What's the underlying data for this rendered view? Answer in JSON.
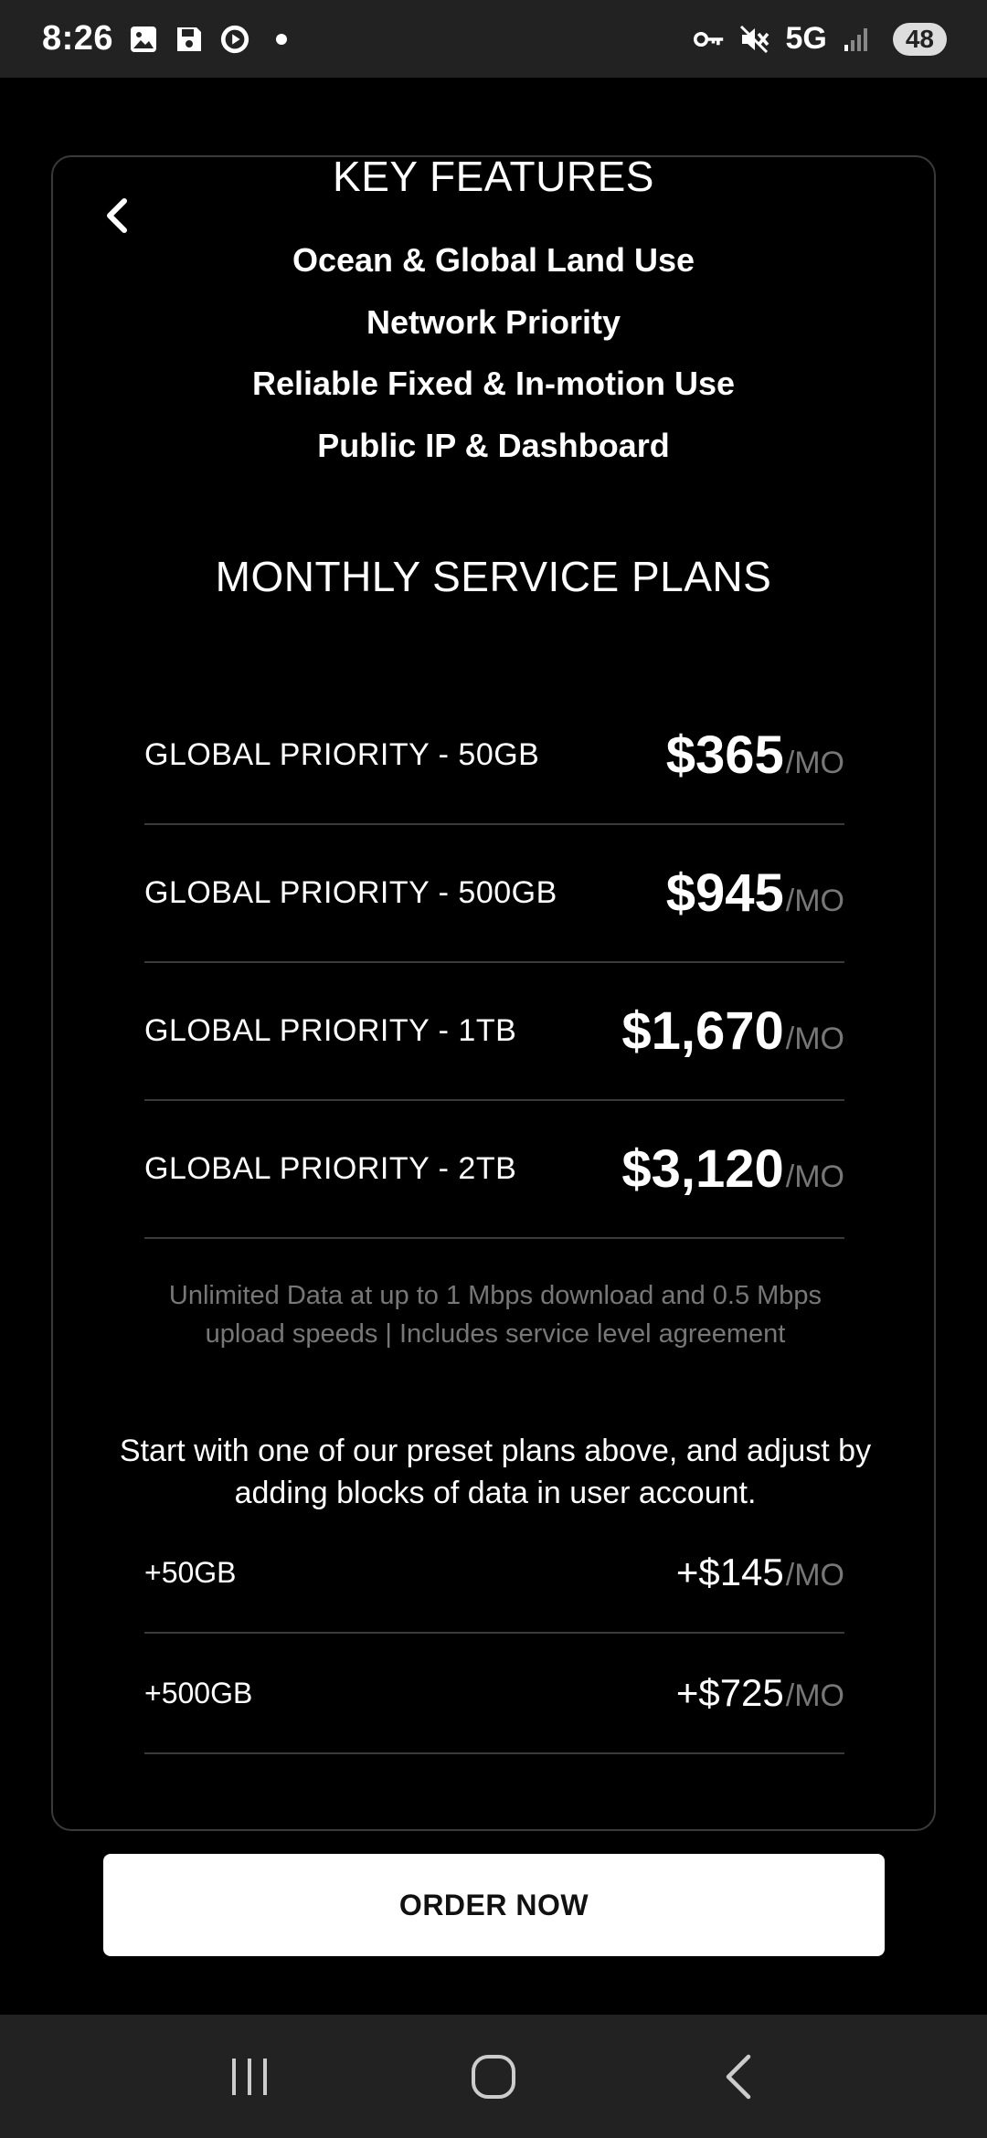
{
  "status_bar": {
    "time": "8:26",
    "network": "5G",
    "battery": "48",
    "left_icons": [
      "gallery-icon",
      "save-icon",
      "play-circle-icon"
    ],
    "right_icons": [
      "key-icon",
      "mute-icon",
      "signal-icon"
    ]
  },
  "key_features": {
    "title": "KEY FEATURES",
    "items": [
      "Ocean & Global Land Use",
      "Network Priority",
      "Reliable Fixed & In-motion Use",
      "Public IP & Dashboard"
    ]
  },
  "plans": {
    "title": "MONTHLY SERVICE PLANS",
    "items": [
      {
        "name": "GLOBAL PRIORITY - 50GB",
        "price": "$365",
        "unit": "/MO"
      },
      {
        "name": "GLOBAL PRIORITY - 500GB",
        "price": "$945",
        "unit": "/MO"
      },
      {
        "name": "GLOBAL PRIORITY - 1TB",
        "price": "$1,670",
        "unit": "/MO"
      },
      {
        "name": "GLOBAL PRIORITY - 2TB",
        "price": "$3,120",
        "unit": "/MO"
      }
    ],
    "note": "Unlimited Data at up to 1 Mbps download and 0.5 Mbps upload speeds | Includes service level agreement"
  },
  "addons": {
    "intro": "Start with one of our preset plans above, and adjust by adding blocks of data in user account.",
    "items": [
      {
        "name": "+50GB",
        "price": "+$145",
        "unit": "/MO"
      },
      {
        "name": "+500GB",
        "price": "+$725",
        "unit": "/MO"
      }
    ]
  },
  "order_button": "ORDER NOW",
  "nav": [
    "recents-icon",
    "home-icon",
    "back-icon"
  ]
}
